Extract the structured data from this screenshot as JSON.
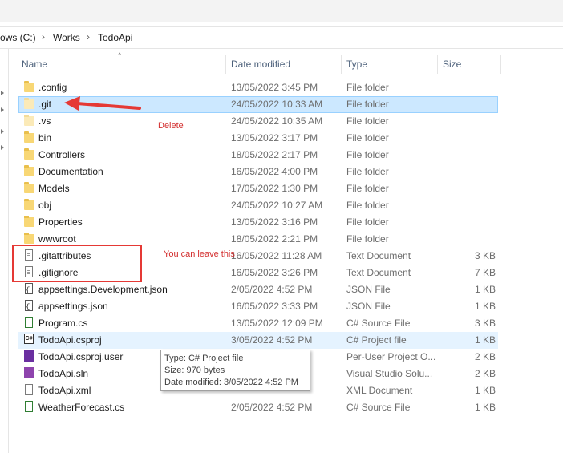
{
  "breadcrumb": {
    "segments": [
      "ows (C:)",
      "Works",
      "TodoApi"
    ],
    "separator": "›"
  },
  "columns": {
    "name": "Name",
    "date": "Date modified",
    "type": "Type",
    "size": "Size"
  },
  "rows": [
    {
      "name": ".config",
      "date": "13/05/2022 3:45 PM",
      "type": "File folder",
      "size": "",
      "icon": "folder-icon"
    },
    {
      "name": ".git",
      "date": "24/05/2022 10:33 AM",
      "type": "File folder",
      "size": "",
      "icon": "folder-icon",
      "selected": true
    },
    {
      "name": ".vs",
      "date": "24/05/2022 10:35 AM",
      "type": "File folder",
      "size": "",
      "icon": "folder-icon"
    },
    {
      "name": "bin",
      "date": "13/05/2022 3:17 PM",
      "type": "File folder",
      "size": "",
      "icon": "folder-icon"
    },
    {
      "name": "Controllers",
      "date": "18/05/2022 2:17 PM",
      "type": "File folder",
      "size": "",
      "icon": "folder-icon"
    },
    {
      "name": "Documentation",
      "date": "16/05/2022 4:00 PM",
      "type": "File folder",
      "size": "",
      "icon": "folder-icon"
    },
    {
      "name": "Models",
      "date": "17/05/2022 1:30 PM",
      "type": "File folder",
      "size": "",
      "icon": "folder-icon"
    },
    {
      "name": "obj",
      "date": "24/05/2022 10:27 AM",
      "type": "File folder",
      "size": "",
      "icon": "folder-icon"
    },
    {
      "name": "Properties",
      "date": "13/05/2022 3:16 PM",
      "type": "File folder",
      "size": "",
      "icon": "folder-icon"
    },
    {
      "name": "wwwroot",
      "date": "18/05/2022 2:21 PM",
      "type": "File folder",
      "size": "",
      "icon": "folder-icon"
    },
    {
      "name": ".gitattributes",
      "date": "16/05/2022 11:28 AM",
      "type": "Text Document",
      "size": "3 KB",
      "icon": "text-document-icon"
    },
    {
      "name": ".gitignore",
      "date": "16/05/2022 3:26 PM",
      "type": "Text Document",
      "size": "7 KB",
      "icon": "text-document-icon"
    },
    {
      "name": "appsettings.Development.json",
      "date": "2/05/2022 4:52 PM",
      "type": "JSON File",
      "size": "1 KB",
      "icon": "json-file-icon"
    },
    {
      "name": "appsettings.json",
      "date": "16/05/2022 3:33 PM",
      "type": "JSON File",
      "size": "1 KB",
      "icon": "json-file-icon"
    },
    {
      "name": "Program.cs",
      "date": "13/05/2022 12:09 PM",
      "type": "C# Source File",
      "size": "3 KB",
      "icon": "csharp-file-icon"
    },
    {
      "name": "TodoApi.csproj",
      "date": "3/05/2022 4:52 PM",
      "type": "C# Project file",
      "size": "1 KB",
      "icon": "csproj-icon"
    },
    {
      "name": "TodoApi.csproj.user",
      "date": "",
      "type": "Per-User Project O...",
      "size": "2 KB",
      "icon": "csproj-user-icon"
    },
    {
      "name": "TodoApi.sln",
      "date": "",
      "type": "Visual Studio Solu...",
      "size": "2 KB",
      "icon": "visual-studio-solution-icon"
    },
    {
      "name": "TodoApi.xml",
      "date": "",
      "type": "XML Document",
      "size": "1 KB",
      "icon": "xml-document-icon"
    },
    {
      "name": "WeatherForecast.cs",
      "date": "2/05/2022 4:52 PM",
      "type": "C# Source File",
      "size": "1 KB",
      "icon": "csharp-file-icon"
    }
  ],
  "annotations": {
    "delete_label": "Delete",
    "leave_label": "You can leave this"
  },
  "tooltip": {
    "type_line": "Type: C# Project file",
    "size_line": "Size: 970 bytes",
    "date_line": "Date modified: 3/05/2022 4:52 PM"
  },
  "colors": {
    "selection": "#cce8ff",
    "annotation_red": "#e53935",
    "folder": "#f8d775"
  }
}
